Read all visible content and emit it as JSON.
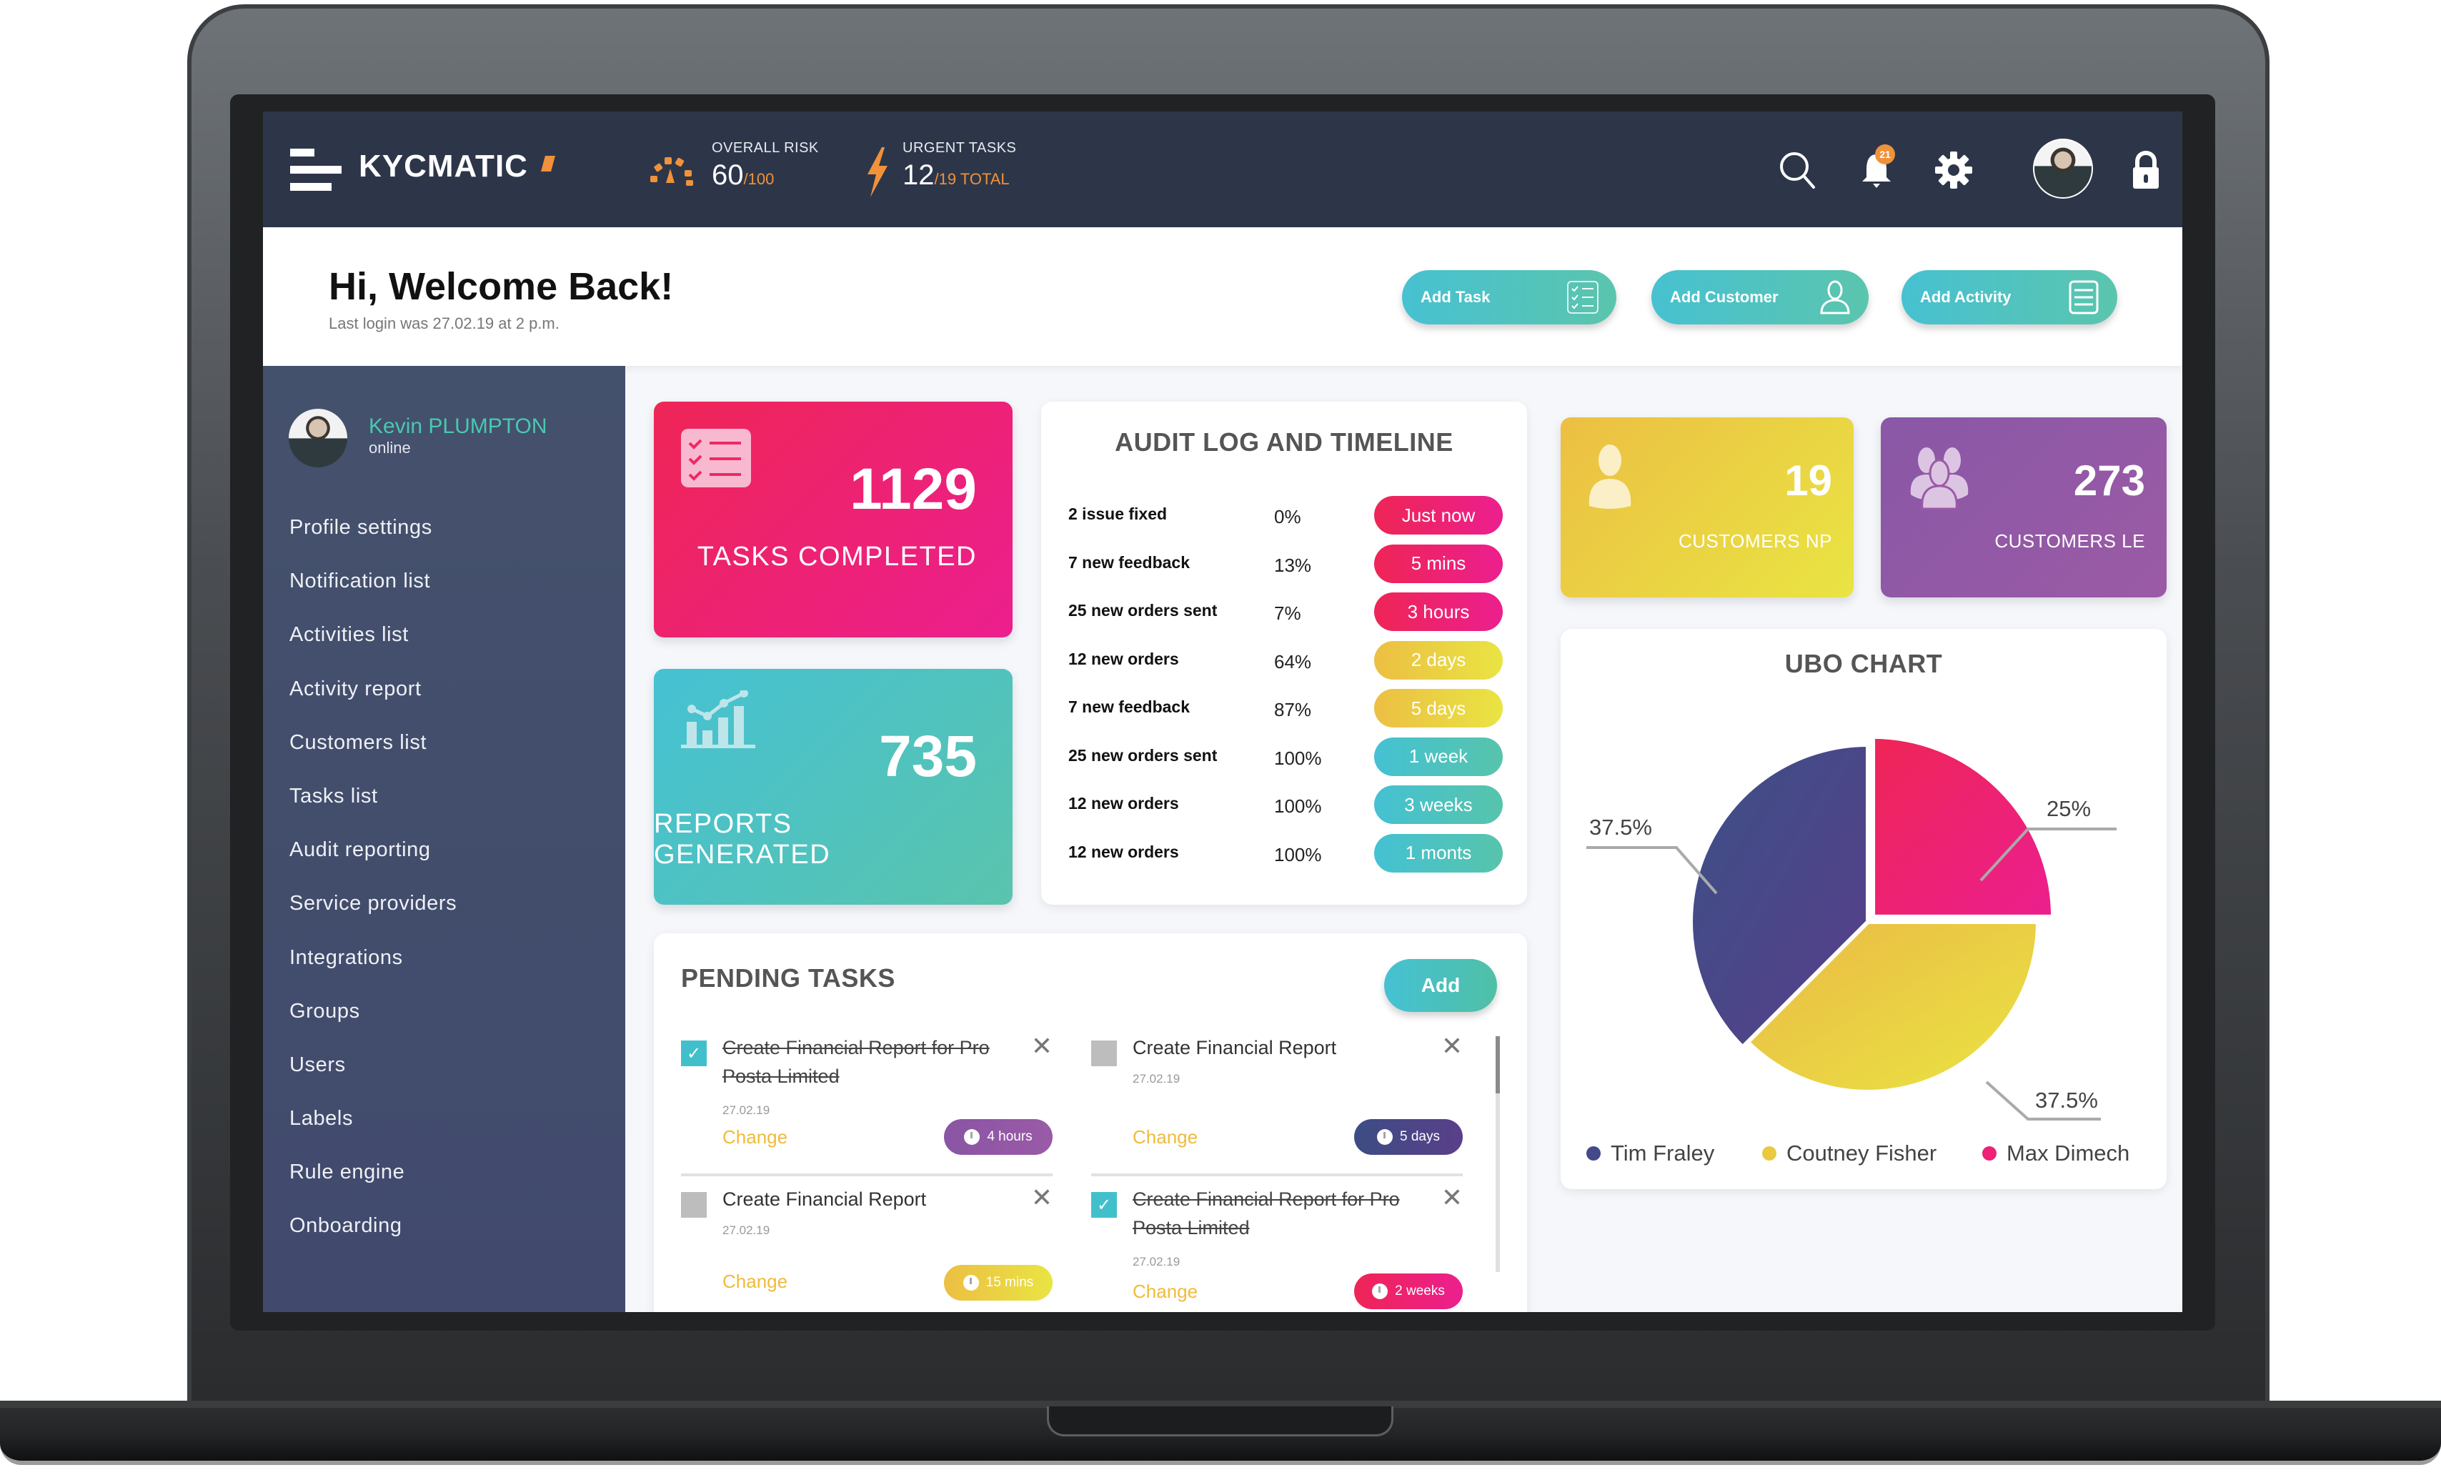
{
  "app": {
    "name": "KYCMATIC"
  },
  "topbar": {
    "overall_risk": {
      "label": "OVERALL RISK",
      "value": "60",
      "suffix": "/100"
    },
    "urgent_tasks": {
      "label": "URGENT TASKS",
      "value": "12",
      "suffix": "/19 TOTAL"
    },
    "notification_count": "21",
    "icons": [
      "search-icon",
      "bell-icon",
      "gear-icon",
      "avatar",
      "lock-icon"
    ]
  },
  "welcome": {
    "title": "Hi, Welcome Back!",
    "last_login": "Last login was 27.02.19 at 2 p.m."
  },
  "quick_actions": [
    {
      "label": "Add Task",
      "icon": "checklist-icon"
    },
    {
      "label": "Add Customer",
      "icon": "user-icon"
    },
    {
      "label": "Add Activity",
      "icon": "list-icon"
    }
  ],
  "sidebar": {
    "user": {
      "name": "Kevin PLUMPTON",
      "status": "online"
    },
    "items": [
      {
        "label": "Profile settings"
      },
      {
        "label": "Notification list"
      },
      {
        "label": "Activities list"
      },
      {
        "label": "Activity report"
      },
      {
        "label": "Customers list"
      },
      {
        "label": "Tasks list"
      },
      {
        "label": "Audit reporting"
      },
      {
        "label": "Service providers"
      },
      {
        "label": "Integrations"
      },
      {
        "label": "Groups"
      },
      {
        "label": "Users"
      },
      {
        "label": "Labels"
      },
      {
        "label": "Rule engine"
      },
      {
        "label": "Onboarding"
      }
    ]
  },
  "metrics": {
    "tasks_completed": {
      "value": "1129",
      "label": "TASKS COMPLETED"
    },
    "reports_generated": {
      "value": "735",
      "label": "REPORTS GENERATED"
    },
    "customers_np": {
      "value": "19",
      "label": "CUSTOMERS NP"
    },
    "customers_le": {
      "value": "273",
      "label": "CUSTOMERS LE"
    }
  },
  "audit": {
    "title": "AUDIT LOG AND TIMELINE",
    "rows": [
      {
        "desc": "2 issue fixed",
        "pct": "0%",
        "time": "Just now",
        "tone": "pink"
      },
      {
        "desc": "7 new feedback",
        "pct": "13%",
        "time": "5 mins",
        "tone": "pink"
      },
      {
        "desc": "25 new orders sent",
        "pct": "7%",
        "time": "3 hours",
        "tone": "pink"
      },
      {
        "desc": "12 new orders",
        "pct": "64%",
        "time": "2 days",
        "tone": "yellow"
      },
      {
        "desc": "7 new feedback",
        "pct": "87%",
        "time": "5 days",
        "tone": "yellow"
      },
      {
        "desc": "25 new orders sent",
        "pct": "100%",
        "time": "1 week",
        "tone": "teal"
      },
      {
        "desc": "12 new orders",
        "pct": "100%",
        "time": "3 weeks",
        "tone": "teal"
      },
      {
        "desc": "12 new orders",
        "pct": "100%",
        "time": "1 monts",
        "tone": "teal"
      }
    ]
  },
  "pending": {
    "title": "PENDING TASKS",
    "add_label": "Add",
    "tasks": [
      {
        "title": "Create Financial Report for Pro Posta Limited",
        "date": "27.02.19",
        "done": true,
        "change": "Change",
        "due": "4 hours",
        "tone": "purple"
      },
      {
        "title": "Create Financial Report",
        "date": "27.02.19",
        "done": false,
        "change": "Change",
        "due": "5 days",
        "tone": "indigo"
      },
      {
        "title": "Create Financial Report",
        "date": "27.02.19",
        "done": false,
        "change": "Change",
        "due": "15 mins",
        "tone": "yellow"
      },
      {
        "title": "Create Financial Report for Pro Posta Limited",
        "date": "27.02.19",
        "done": true,
        "change": "Change",
        "due": "2 weeks",
        "tone": "pink"
      }
    ]
  },
  "colors": {
    "pink": [
      "#ee2556",
      "#ec1f8e"
    ],
    "yellow": [
      "#ecbf43",
      "#e9e443"
    ],
    "teal": [
      "#44c1d3",
      "#57c4ab"
    ],
    "purple": [
      "#8a55a5",
      "#9a5aa6"
    ],
    "indigo": [
      "#3c4d84",
      "#5a3f8a"
    ],
    "accent_orange": "#f0923a",
    "accent_green": "#49c8b0"
  },
  "chart_data": {
    "type": "pie",
    "title": "UBO CHART",
    "categories": [
      "Tim Fraley",
      "Coutney Fisher",
      "Max Dimech"
    ],
    "values": [
      37.5,
      37.5,
      25
    ],
    "labels": [
      "37.5%",
      "37.5%",
      "25%"
    ],
    "colors": [
      "#43498a",
      "#eac840",
      "#ee2176"
    ],
    "legend": "bottom",
    "exploded": "Max Dimech"
  }
}
